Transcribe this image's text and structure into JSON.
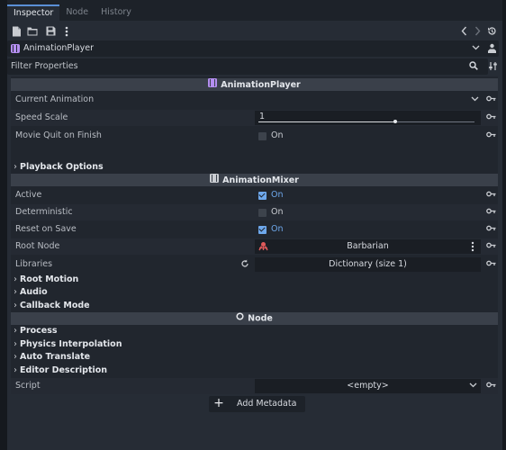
{
  "tabs": [
    {
      "label": "Inspector",
      "active": true
    },
    {
      "label": "Node",
      "active": false
    },
    {
      "label": "History",
      "active": false
    }
  ],
  "toolbar": {
    "icons": [
      "new-resource-icon",
      "open-resource-icon",
      "save-icon",
      "more-icon",
      "history-back-icon",
      "history-forward-icon",
      "object-history-icon"
    ]
  },
  "object": {
    "name": "AnimationPlayer",
    "icon": "animation-player-icon"
  },
  "filter": {
    "placeholder": "Filter Properties"
  },
  "sections": {
    "animation_player": "AnimationPlayer",
    "animation_mixer": "AnimationMixer",
    "node": "Node"
  },
  "properties": {
    "current_animation": {
      "label": "Current Animation",
      "value": ""
    },
    "speed_scale": {
      "label": "Speed Scale",
      "value": "1",
      "slider_fraction": 0.63
    },
    "movie_quit": {
      "label": "Movie Quit on Finish",
      "checked": false,
      "text": "On"
    },
    "active": {
      "label": "Active",
      "checked": true,
      "text": "On"
    },
    "deterministic": {
      "label": "Deterministic",
      "checked": false,
      "text": "On"
    },
    "reset_on_save": {
      "label": "Reset on Save",
      "checked": true,
      "text": "On"
    },
    "root_node": {
      "label": "Root Node",
      "value": "Barbarian"
    },
    "libraries": {
      "label": "Libraries",
      "value": "Dictionary (size 1)"
    },
    "script": {
      "label": "Script",
      "value": "<empty>"
    }
  },
  "groups": {
    "playback_options": "Playback Options",
    "root_motion": "Root Motion",
    "audio": "Audio",
    "callback_mode": "Callback Mode",
    "process": "Process",
    "physics_interpolation": "Physics Interpolation",
    "auto_translate": "Auto Translate",
    "editor_description": "Editor Description"
  },
  "add_metadata": "Add Metadata",
  "colors": {
    "accent": "#6ea8ec",
    "animation_icon": "#b48ef0",
    "node_icon": "#e05a5a"
  }
}
